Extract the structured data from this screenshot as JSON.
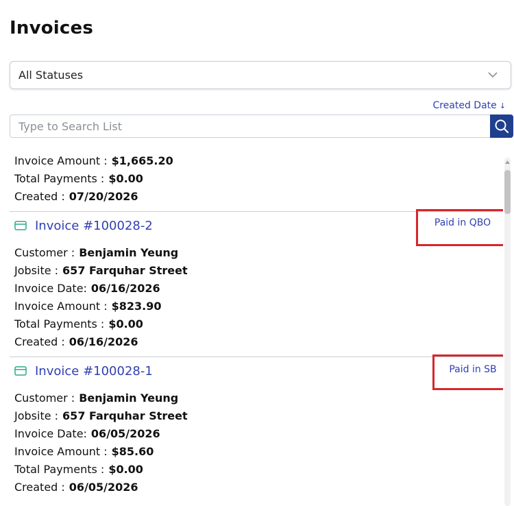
{
  "page": {
    "title": "Invoices"
  },
  "filter": {
    "selected": "All Statuses"
  },
  "sort": {
    "label": "Created Date",
    "arrow": "↓"
  },
  "search": {
    "placeholder": "Type to Search List"
  },
  "labels": {
    "customer": "Customer :",
    "jobsite": "Jobsite :",
    "invoice_date": "Invoice Date:",
    "invoice_amount": "Invoice Amount :",
    "total_payments": "Total Payments :",
    "created": "Created :"
  },
  "partial_item": {
    "invoice_amount": "$1,665.20",
    "total_payments": "$0.00",
    "created": "07/20/2026"
  },
  "invoices": [
    {
      "title": "Invoice #100028-2",
      "status": "Paid in QBO",
      "customer": "Benjamin Yeung",
      "jobsite": "657 Farquhar Street",
      "invoice_date": "06/16/2026",
      "invoice_amount": "$823.90",
      "total_payments": "$0.00",
      "created": "06/16/2026"
    },
    {
      "title": "Invoice #100028-1",
      "status": "Paid in SB",
      "customer": "Benjamin Yeung",
      "jobsite": "657 Farquhar Street",
      "invoice_date": "06/05/2026",
      "invoice_amount": "$85.60",
      "total_payments": "$0.00",
      "created": "06/05/2026"
    }
  ],
  "colors": {
    "link": "#2f3fb3",
    "highlight": "#d6262a",
    "search_button": "#1f3f8f",
    "icon": "#2aa88a"
  }
}
